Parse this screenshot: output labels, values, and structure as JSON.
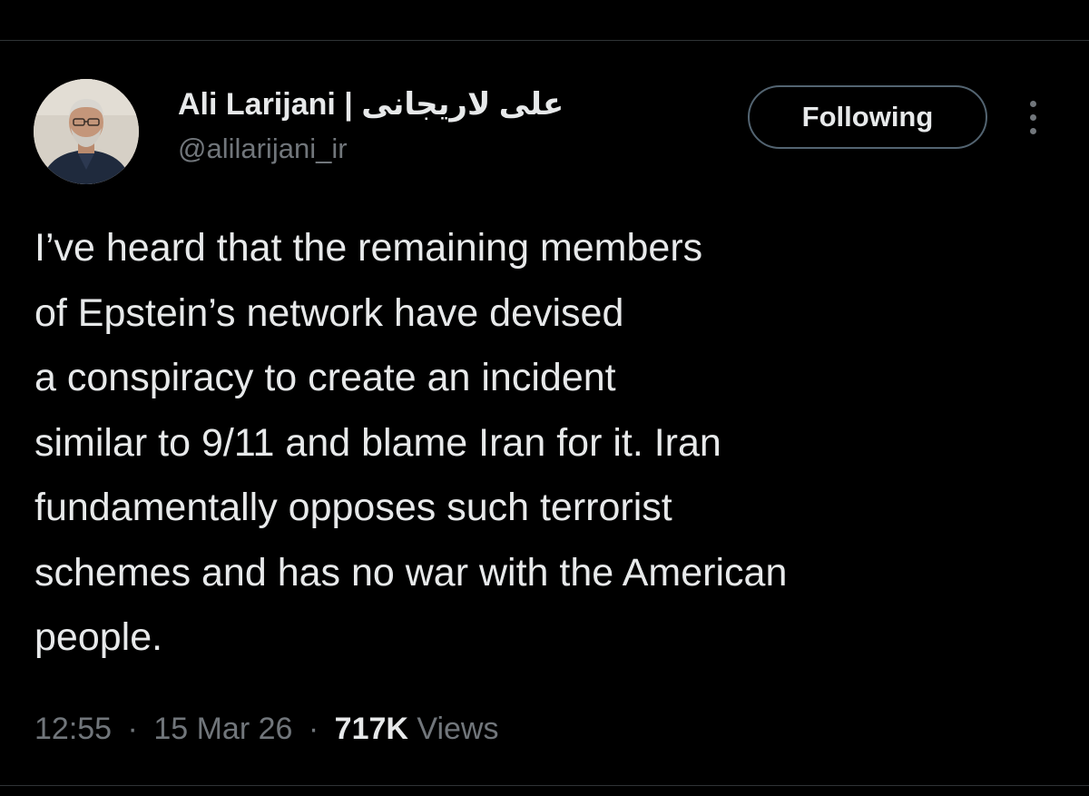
{
  "author": {
    "name": "Ali Larijani | علی لاریجانی",
    "handle": "@alilarijani_ir"
  },
  "follow_button": {
    "label": "Following"
  },
  "tweet": {
    "lines": [
      "I’ve heard that the remaining members",
      "of Epstein’s network have devised",
      "a conspiracy to create an incident",
      "similar to 9/11 and blame Iran for it. Iran",
      "fundamentally opposes such terrorist",
      "schemes and has no war with the American",
      "people."
    ]
  },
  "meta": {
    "time": "12:55",
    "separator": "·",
    "date": "15 Mar 26",
    "views_count": "717K",
    "views_label": "Views"
  },
  "icons": {
    "more": "more-options-icon"
  },
  "colors": {
    "background": "#000000",
    "text_primary": "#e7e9ea",
    "text_secondary": "#71767b",
    "border": "#2f3336"
  }
}
